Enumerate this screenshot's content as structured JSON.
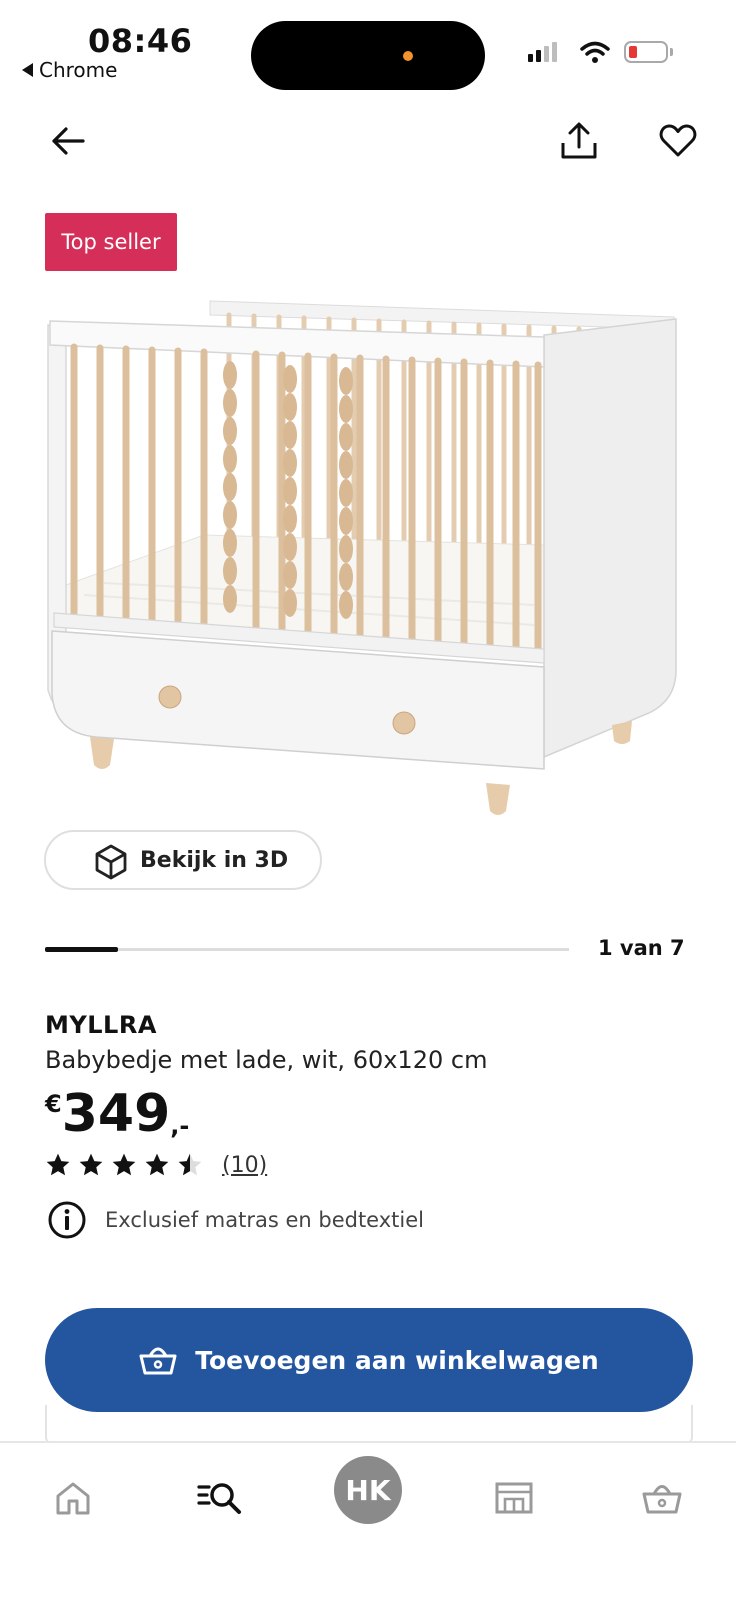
{
  "status_bar": {
    "time": "08:46",
    "back_app": "Chrome"
  },
  "colors": {
    "badge": "#d52f59",
    "primary": "#2456a0",
    "avatar": "#8a8a8a"
  },
  "header": {
    "back_icon": "arrow-left-icon",
    "share_icon": "share-icon",
    "favorite_icon": "heart-icon"
  },
  "product": {
    "badge": "Top seller",
    "view_3d_label": "Bekijk in 3D",
    "gallery_counter": "1 van 7",
    "gallery_progress": 0.14,
    "name": "MYLLRA",
    "description": "Babybedje met lade, wit, 60x120 cm",
    "price": {
      "currency": "€",
      "amount": "349",
      "suffix": ",-"
    },
    "rating": {
      "stars": 4.5,
      "max": 5,
      "count_label": "(10)"
    },
    "info_note": "Exclusief matras en bedtextiel",
    "add_to_cart_label": "Toevoegen aan winkelwagen"
  },
  "tabbar": {
    "items": [
      {
        "icon": "home-icon"
      },
      {
        "icon": "search-list-icon"
      },
      {
        "icon": "avatar",
        "label": "HK"
      },
      {
        "icon": "store-icon"
      },
      {
        "icon": "cart-icon"
      }
    ]
  }
}
